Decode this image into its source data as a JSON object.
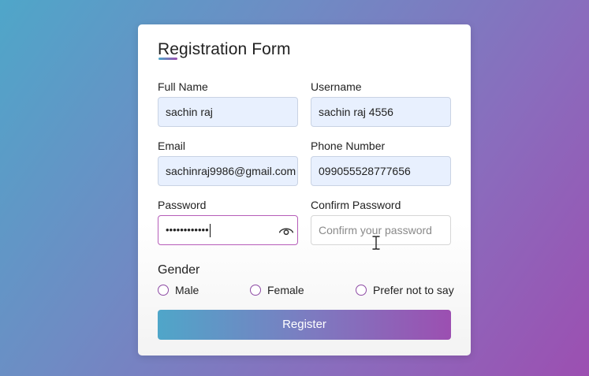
{
  "form": {
    "title": "Registration Form"
  },
  "fields": {
    "full_name": {
      "label": "Full Name",
      "value": "sachin raj"
    },
    "username": {
      "label": "Username",
      "value": "sachin raj 4556"
    },
    "email": {
      "label": "Email",
      "value": "sachinraj9986@gmail.com"
    },
    "phone": {
      "label": "Phone Number",
      "value": "099055528777656"
    },
    "password": {
      "label": "Password",
      "value": "••••••••••••",
      "toggle_icon": "eye-icon"
    },
    "confirm_password": {
      "label": "Confirm Password",
      "value": "",
      "placeholder": "Confirm your password"
    }
  },
  "gender": {
    "label": "Gender",
    "options": [
      "Male",
      "Female",
      "Prefer not to say"
    ]
  },
  "register_button": {
    "label": "Register"
  },
  "colors": {
    "gradient_start": "#4fa6c9",
    "gradient_end": "#9c4fb1",
    "autofill_background": "#e8f0fe",
    "radio_border": "#8d4aa4"
  }
}
